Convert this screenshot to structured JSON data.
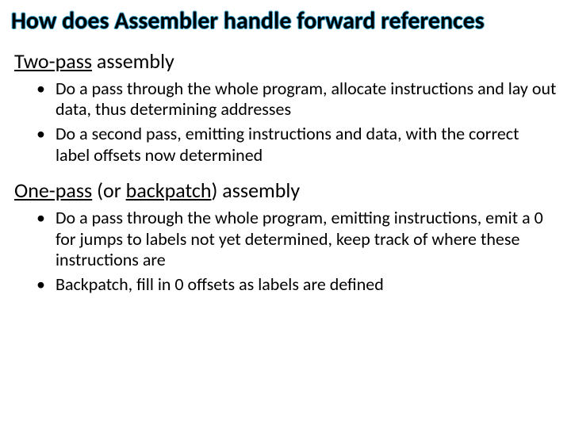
{
  "title": "How does Assembler handle forward references",
  "section1": {
    "heading_kw": "Two-pass",
    "heading_rest": " assembly",
    "bullets": [
      "Do a pass through the whole program, allocate instructions and lay out data, thus determining addresses",
      "Do a second pass, emitting instructions and data, with the correct label offsets now determined"
    ]
  },
  "section2": {
    "heading_kw1": "One-pass",
    "heading_mid": " (or ",
    "heading_kw2": "backpatch",
    "heading_end": ") assembly",
    "bullets": [
      "Do a pass through the whole program, emitting instructions, emit a 0 for jumps to labels not yet determined, keep track of where these instructions are",
      "Backpatch, fill in 0 offsets as labels are defined"
    ]
  }
}
